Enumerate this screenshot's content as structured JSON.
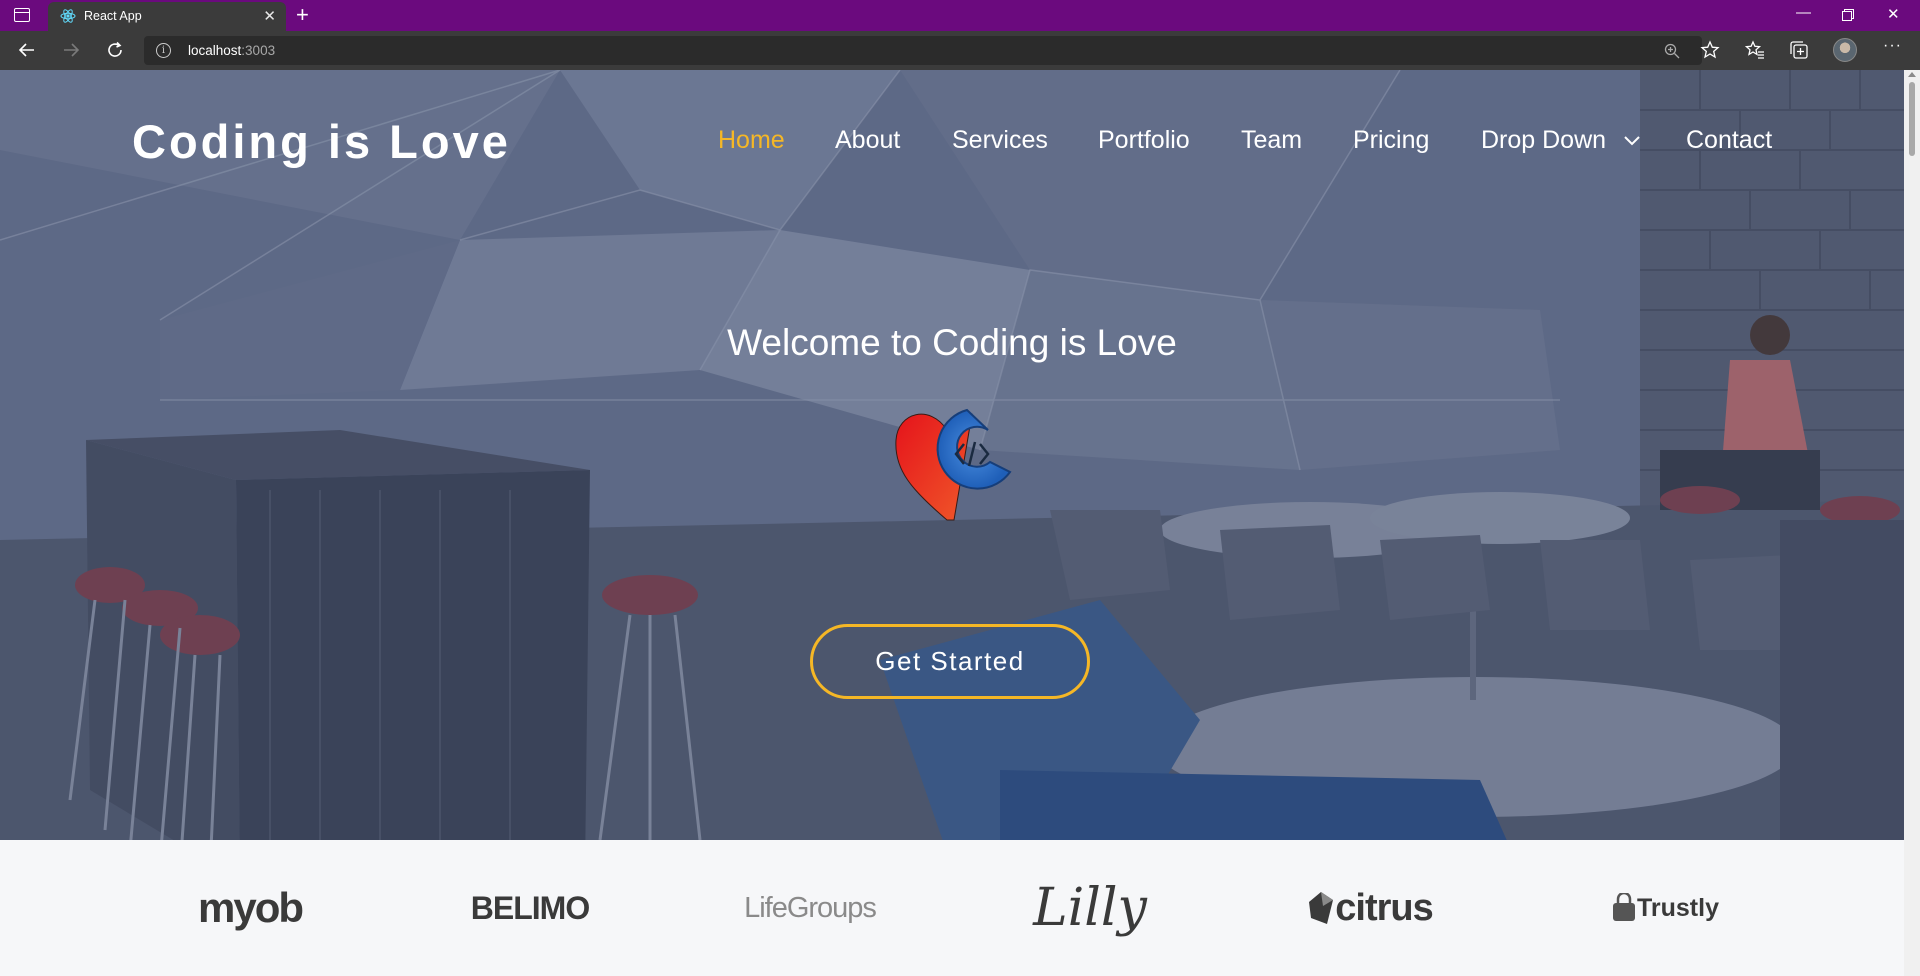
{
  "browser": {
    "tab_title": "React App",
    "url_host": "localhost",
    "url_port": ":3003"
  },
  "site": {
    "brand": "Coding is Love",
    "nav": [
      {
        "label": "Home",
        "active": true
      },
      {
        "label": "About",
        "active": false
      },
      {
        "label": "Services",
        "active": false
      },
      {
        "label": "Portfolio",
        "active": false
      },
      {
        "label": "Team",
        "active": false
      },
      {
        "label": "Pricing",
        "active": false
      },
      {
        "label": "Drop Down",
        "active": false,
        "dropdown": true
      },
      {
        "label": "Contact",
        "active": false
      }
    ],
    "hero": {
      "heading": "Welcome to Coding is Love",
      "cta_label": "Get Started"
    },
    "clients": [
      {
        "name": "myob"
      },
      {
        "name": "BELIMO"
      },
      {
        "name": "LifeGroups"
      },
      {
        "name": "Lilly"
      },
      {
        "name": "citrus"
      },
      {
        "name": "Trustly"
      }
    ]
  },
  "colors": {
    "accent": "#f5b726",
    "titlebar": "#6b0a7e",
    "toolbar": "#3b3b3b"
  }
}
